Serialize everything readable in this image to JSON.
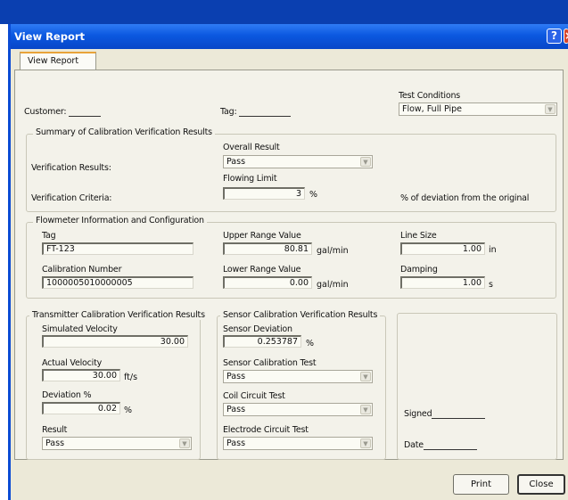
{
  "window": {
    "title": "View Report",
    "help_glyph": "?",
    "close_glyph": "×"
  },
  "tab": {
    "label": "View Report"
  },
  "header": {
    "customer_label": "Customer:",
    "tag_label": "Tag:",
    "test_conditions_label": "Test Conditions",
    "test_conditions_value": "Flow, Full Pipe"
  },
  "summary": {
    "title": "Summary of Calibration Verification Results",
    "verification_results_label": "Verification Results:",
    "overall_result_label": "Overall Result",
    "overall_result_value": "Pass",
    "verification_criteria_label": "Verification Criteria:",
    "flowing_limit_label": "Flowing Limit",
    "flowing_limit_value": "3",
    "flowing_limit_unit": "%",
    "deviation_note": "% of deviation from the original"
  },
  "flowmeter": {
    "title": "Flowmeter Information and Configuration",
    "tag_label": "Tag",
    "tag_value": "FT-123",
    "urv_label": "Upper Range Value",
    "urv_value": "80.81",
    "urv_unit": "gal/min",
    "line_size_label": "Line Size",
    "line_size_value": "1.00",
    "line_size_unit": "in",
    "cal_number_label": "Calibration Number",
    "cal_number_value": "1000005010000005",
    "lrv_label": "Lower Range Value",
    "lrv_value": "0.00",
    "lrv_unit": "gal/min",
    "damping_label": "Damping",
    "damping_value": "1.00",
    "damping_unit": "s"
  },
  "transmitter": {
    "title": "Transmitter Calibration Verification Results",
    "sim_velocity_label": "Simulated Velocity",
    "sim_velocity_value": "30.00",
    "act_velocity_label": "Actual Velocity",
    "act_velocity_value": "30.00",
    "act_velocity_unit": "ft/s",
    "deviation_label": "Deviation %",
    "deviation_value": "0.02",
    "deviation_unit": "%",
    "result_label": "Result",
    "result_value": "Pass"
  },
  "sensor": {
    "title": "Sensor Calibration Verification Results",
    "sensor_dev_label": "Sensor Deviation",
    "sensor_dev_value": "0.253787",
    "sensor_dev_unit": "%",
    "sensor_cal_test_label": "Sensor Calibration Test",
    "sensor_cal_test_value": "Pass",
    "coil_test_label": "Coil Circuit Test",
    "coil_test_value": "Pass",
    "electrode_test_label": "Electrode Circuit Test",
    "electrode_test_value": "Pass"
  },
  "signoff": {
    "signed_label": "Signed",
    "date_label": "Date"
  },
  "buttons": {
    "print": "Print",
    "close": "Close"
  }
}
